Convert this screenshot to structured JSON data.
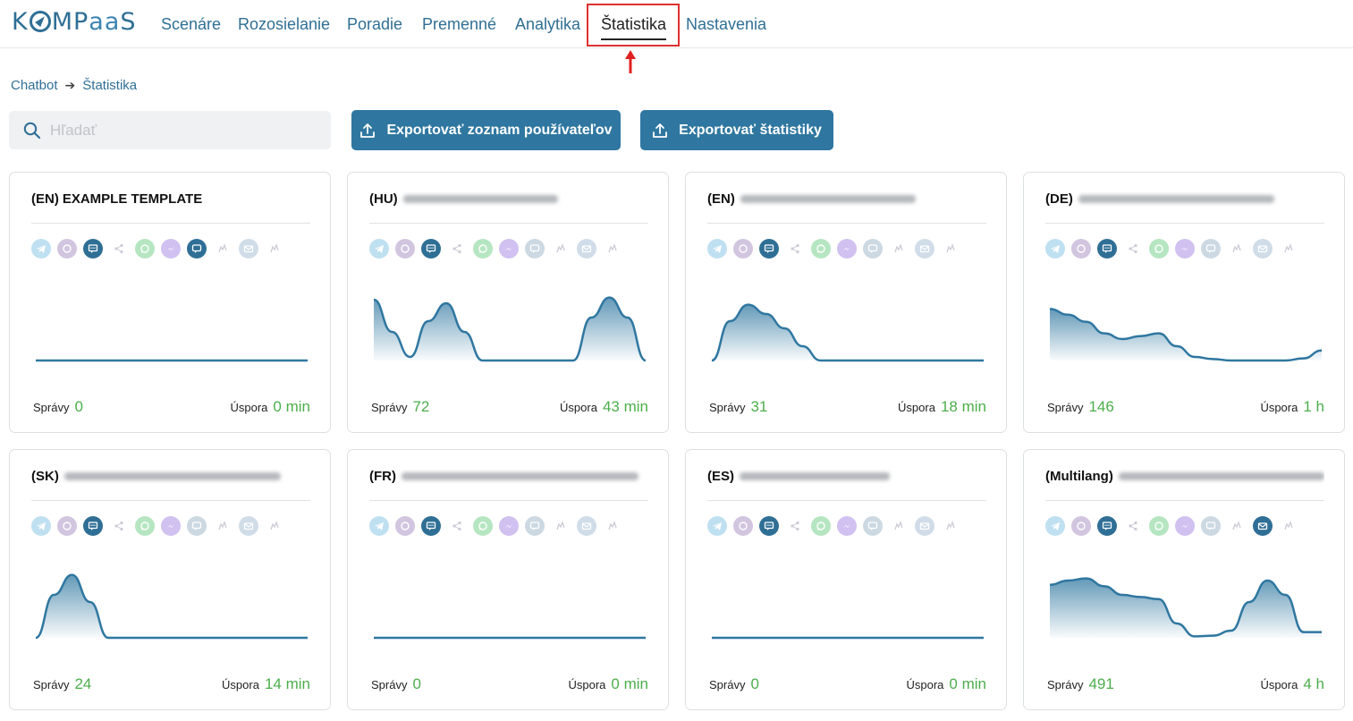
{
  "app": {
    "logo_prefix": "K",
    "logo_mid": "MP",
    "logo_aa": "aa",
    "logo_suffix": "S"
  },
  "nav": {
    "items": [
      {
        "label": "Scenáre",
        "name": "nav-scenare"
      },
      {
        "label": "Rozosielanie",
        "name": "nav-rozosielanie"
      },
      {
        "label": "Poradie",
        "name": "nav-poradie"
      },
      {
        "label": "Premenné",
        "name": "nav-premenne"
      },
      {
        "label": "Analytika",
        "name": "nav-analytika"
      },
      {
        "label": "Štatistika",
        "name": "nav-statistika",
        "active": true
      },
      {
        "label": "Nastavenia",
        "name": "nav-nastavenia"
      }
    ]
  },
  "breadcrumb": {
    "root": "Chatbot",
    "current": "Štatistika"
  },
  "search": {
    "placeholder": "Hľadať",
    "value": ""
  },
  "buttons": {
    "export_users": "Exportovať zoznam používateľov",
    "export_stats": "Exportovať štatistiky"
  },
  "labels": {
    "messages": "Správy",
    "savings": "Úspora"
  },
  "colors": {
    "accent": "#2f77a0",
    "green": "#4cae4c",
    "highlight": "#e03030"
  },
  "channel_icons": [
    "telegram-icon",
    "viber-icon",
    "webchat-icon",
    "share-icon",
    "whatsapp-icon",
    "messenger-icon",
    "chat-icon",
    "zapier-icon",
    "email-icon",
    "api-icon"
  ],
  "cards": [
    {
      "prefix": "(EN)",
      "title": "EXAMPLE TEMPLATE",
      "blurred": false,
      "messages": "0",
      "savings": "0 min",
      "active_channels": [
        2,
        6
      ],
      "trend": [
        0,
        0,
        0,
        0,
        0,
        0,
        0,
        0,
        0,
        0,
        0,
        0,
        0,
        0,
        0,
        0
      ]
    },
    {
      "prefix": "(HU)",
      "title": "",
      "blurred": true,
      "messages": "72",
      "savings": "43 min",
      "active_channels": [
        2
      ],
      "trend": [
        85,
        40,
        5,
        55,
        80,
        40,
        0,
        0,
        0,
        0,
        0,
        0,
        60,
        88,
        60,
        0
      ]
    },
    {
      "prefix": "(EN)",
      "title": "",
      "blurred": true,
      "messages": "31",
      "savings": "18 min",
      "active_channels": [
        2
      ],
      "trend": [
        0,
        55,
        78,
        65,
        45,
        20,
        0,
        0,
        0,
        0,
        0,
        0,
        0,
        0,
        0,
        0
      ]
    },
    {
      "prefix": "(DE)",
      "title": "",
      "blurred": true,
      "messages": "146",
      "savings": "1 h",
      "active_channels": [
        2
      ],
      "trend": [
        72,
        64,
        54,
        38,
        30,
        34,
        38,
        20,
        5,
        2,
        0,
        0,
        0,
        0,
        3,
        14
      ]
    },
    {
      "prefix": "(SK)",
      "title": "",
      "blurred": true,
      "messages": "24",
      "savings": "14 min",
      "active_channels": [
        2
      ],
      "trend": [
        0,
        60,
        88,
        50,
        0,
        0,
        0,
        0,
        0,
        0,
        0,
        0,
        0,
        0,
        0,
        0
      ]
    },
    {
      "prefix": "(FR)",
      "title": "",
      "blurred": true,
      "messages": "0",
      "savings": "0 min",
      "active_channels": [
        2
      ],
      "trend": [
        0,
        0,
        0,
        0,
        0,
        0,
        0,
        0,
        0,
        0,
        0,
        0,
        0,
        0,
        0,
        0
      ]
    },
    {
      "prefix": "(ES)",
      "title": "",
      "blurred": true,
      "messages": "0",
      "savings": "0 min",
      "active_channels": [
        2
      ],
      "trend": [
        0,
        0,
        0,
        0,
        0,
        0,
        0,
        0,
        0,
        0,
        0,
        0,
        0,
        0,
        0,
        0
      ]
    },
    {
      "prefix": "(Multilang)",
      "title": "",
      "blurred": true,
      "messages": "491",
      "savings": "4 h",
      "active_channels": [
        2,
        8
      ],
      "trend": [
        74,
        80,
        83,
        72,
        60,
        57,
        54,
        20,
        2,
        3,
        10,
        50,
        80,
        60,
        8,
        8
      ]
    }
  ]
}
